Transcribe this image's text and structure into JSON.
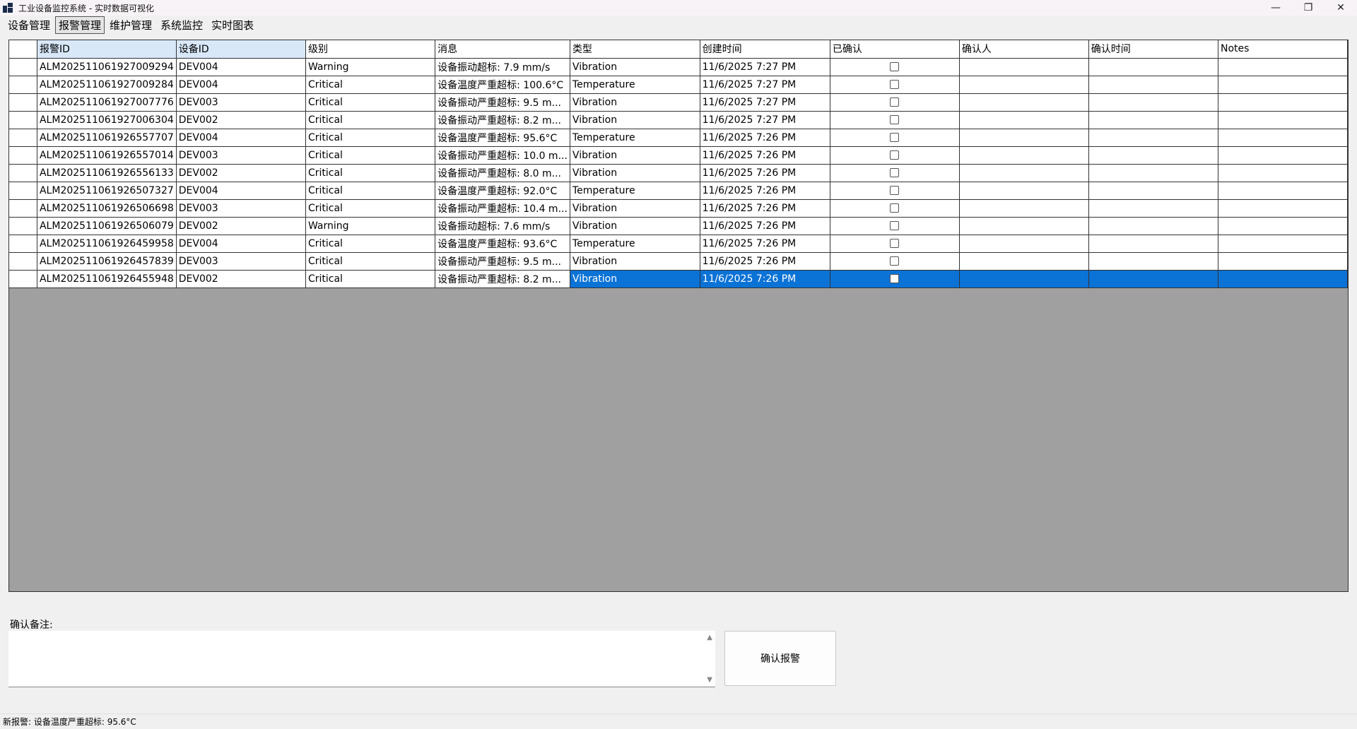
{
  "window": {
    "title": "工业设备监控系统 - 实时数据可视化",
    "controls": [
      "—",
      "❐",
      "✕"
    ]
  },
  "menu": [
    {
      "label": "设备管理",
      "active": false
    },
    {
      "label": "报警管理",
      "active": true
    },
    {
      "label": "维护管理",
      "active": false
    },
    {
      "label": "系统监控",
      "active": false
    },
    {
      "label": "实时图表",
      "active": false
    }
  ],
  "table": {
    "columns": [
      "报警ID",
      "设备ID",
      "级别",
      "消息",
      "类型",
      "创建时间",
      "已确认",
      "确认人",
      "确认时间",
      "Notes"
    ],
    "rows": [
      {
        "id": "ALM202511061927009294",
        "device": "DEV004",
        "level": "Warning",
        "message": "设备振动超标: 7.9 mm/s",
        "type": "Vibration",
        "time": "11/6/2025 7:27 PM",
        "confirmed": false
      },
      {
        "id": "ALM202511061927009284",
        "device": "DEV004",
        "level": "Critical",
        "message": "设备温度严重超标: 100.6°C",
        "type": "Temperature",
        "time": "11/6/2025 7:27 PM",
        "confirmed": false
      },
      {
        "id": "ALM202511061927007776",
        "device": "DEV003",
        "level": "Critical",
        "message": "设备振动严重超标: 9.5 m...",
        "type": "Vibration",
        "time": "11/6/2025 7:27 PM",
        "confirmed": false
      },
      {
        "id": "ALM202511061927006304",
        "device": "DEV002",
        "level": "Critical",
        "message": "设备振动严重超标: 8.2 m...",
        "type": "Vibration",
        "time": "11/6/2025 7:27 PM",
        "confirmed": false
      },
      {
        "id": "ALM202511061926557707",
        "device": "DEV004",
        "level": "Critical",
        "message": "设备温度严重超标: 95.6°C",
        "type": "Temperature",
        "time": "11/6/2025 7:26 PM",
        "confirmed": false
      },
      {
        "id": "ALM202511061926557014",
        "device": "DEV003",
        "level": "Critical",
        "message": "设备振动严重超标: 10.0 m...",
        "type": "Vibration",
        "time": "11/6/2025 7:26 PM",
        "confirmed": false
      },
      {
        "id": "ALM202511061926556133",
        "device": "DEV002",
        "level": "Critical",
        "message": "设备振动严重超标: 8.0 m...",
        "type": "Vibration",
        "time": "11/6/2025 7:26 PM",
        "confirmed": false
      },
      {
        "id": "ALM202511061926507327",
        "device": "DEV004",
        "level": "Critical",
        "message": "设备温度严重超标: 92.0°C",
        "type": "Temperature",
        "time": "11/6/2025 7:26 PM",
        "confirmed": false
      },
      {
        "id": "ALM202511061926506698",
        "device": "DEV003",
        "level": "Critical",
        "message": "设备振动严重超标: 10.4 m...",
        "type": "Vibration",
        "time": "11/6/2025 7:26 PM",
        "confirmed": false
      },
      {
        "id": "ALM202511061926506079",
        "device": "DEV002",
        "level": "Warning",
        "message": "设备振动超标: 7.6 mm/s",
        "type": "Vibration",
        "time": "11/6/2025 7:26 PM",
        "confirmed": false
      },
      {
        "id": "ALM202511061926459958",
        "device": "DEV004",
        "level": "Critical",
        "message": "设备温度严重超标: 93.6°C",
        "type": "Temperature",
        "time": "11/6/2025 7:26 PM",
        "confirmed": false
      },
      {
        "id": "ALM202511061926457839",
        "device": "DEV003",
        "level": "Critical",
        "message": "设备振动严重超标: 9.5 m...",
        "type": "Vibration",
        "time": "11/6/2025 7:26 PM",
        "confirmed": false
      },
      {
        "id": "ALM202511061926455948",
        "device": "DEV002",
        "level": "Critical",
        "message": "设备振动严重超标: 8.2 m...",
        "type": "Vibration",
        "time": "11/6/2025 7:26 PM",
        "confirmed": false,
        "selected": true
      }
    ]
  },
  "notes": {
    "label": "确认备注:",
    "value": ""
  },
  "confirm_button": "确认报警",
  "status": "新报警: 设备温度严重超标: 95.6°C",
  "colors": {
    "selection": "#0b72d6",
    "header_highlight": "#d8e8f8",
    "grid_background": "#a0a0a0"
  }
}
